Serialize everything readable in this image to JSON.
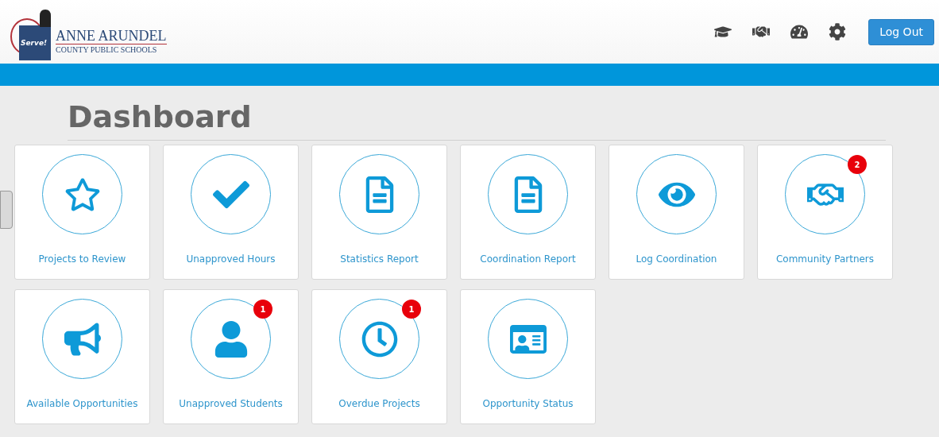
{
  "header": {
    "logo": {
      "badge_text": "Serve!",
      "title": "ANNE ARUNDEL",
      "subtitle": "COUNTY PUBLIC SCHOOLS"
    },
    "nav_icons": [
      {
        "kind": "graduation"
      },
      {
        "kind": "handshake"
      },
      {
        "kind": "gauge"
      },
      {
        "kind": "settings"
      }
    ],
    "logout": "Log Out"
  },
  "page_title": "Dashboard",
  "tiles": [
    {
      "kind": "star",
      "label": "Projects to Review"
    },
    {
      "kind": "check",
      "label": "Unapproved Hours"
    },
    {
      "kind": "document",
      "label": "Statistics Report"
    },
    {
      "kind": "document",
      "label": "Coordination Report"
    },
    {
      "kind": "eye",
      "label": "Log Coordination"
    },
    {
      "kind": "handshake",
      "label": "Community Partners",
      "badge": "2"
    },
    {
      "kind": "megaphone",
      "label": "Available Opportunities"
    },
    {
      "kind": "user",
      "label": "Unapproved Students",
      "badge": "1"
    },
    {
      "kind": "clock",
      "label": "Overdue Projects",
      "badge": "1"
    },
    {
      "kind": "idcard",
      "label": "Opportunity Status"
    }
  ]
}
